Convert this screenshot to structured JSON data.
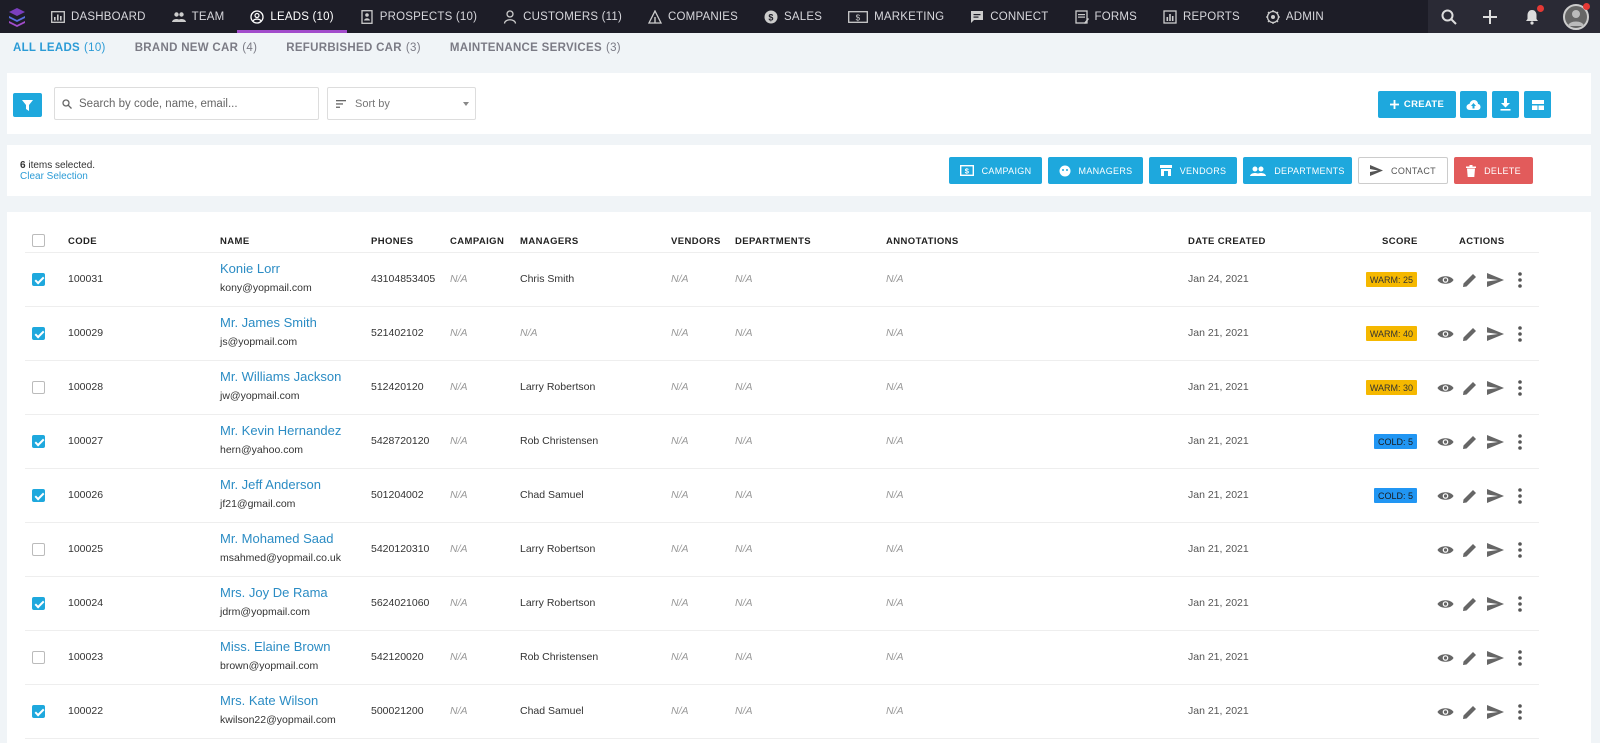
{
  "nav": {
    "items": [
      {
        "label": "DASHBOARD",
        "icon": "dashboard-icon"
      },
      {
        "label": "TEAM",
        "icon": "team-icon"
      },
      {
        "label": "LEADS (10)",
        "icon": "leads-icon",
        "active": true
      },
      {
        "label": "PROSPECTS (10)",
        "icon": "prospects-icon"
      },
      {
        "label": "CUSTOMERS (11)",
        "icon": "customers-icon"
      },
      {
        "label": "COMPANIES",
        "icon": "companies-icon"
      },
      {
        "label": "SALES",
        "icon": "sales-icon"
      },
      {
        "label": "MARKETING",
        "icon": "marketing-icon"
      },
      {
        "label": "CONNECT",
        "icon": "connect-icon"
      },
      {
        "label": "FORMS",
        "icon": "forms-icon"
      },
      {
        "label": "REPORTS",
        "icon": "reports-icon"
      },
      {
        "label": "ADMIN",
        "icon": "admin-icon"
      }
    ]
  },
  "subtabs": [
    {
      "label": "ALL LEADS",
      "count": "(10)",
      "active": true
    },
    {
      "label": "BRAND NEW CAR",
      "count": "(4)"
    },
    {
      "label": "REFURBISHED CAR",
      "count": "(3)"
    },
    {
      "label": "MAINTENANCE SERVICES",
      "count": "(3)"
    }
  ],
  "toolbar": {
    "search_placeholder": "Search by code, name, email...",
    "sort_label": "Sort by",
    "create_label": "CREATE"
  },
  "selection": {
    "count": "6",
    "text": " items selected.",
    "clear_label": "Clear Selection",
    "actions": [
      {
        "label": "CAMPAIGN",
        "icon": "campaign-icon"
      },
      {
        "label": "MANAGERS",
        "icon": "managers-icon"
      },
      {
        "label": "VENDORS",
        "icon": "vendors-icon"
      },
      {
        "label": "DEPARTMENTS",
        "icon": "departments-icon"
      },
      {
        "label": "CONTACT",
        "icon": "send-icon"
      },
      {
        "label": "DELETE",
        "icon": "trash-icon"
      }
    ]
  },
  "table": {
    "headers": {
      "code": "CODE",
      "name": "NAME",
      "phones": "PHONES",
      "campaign": "CAMPAIGN",
      "managers": "MANAGERS",
      "vendors": "VENDORS",
      "departments": "DEPARTMENTS",
      "annotations": "ANNOTATIONS",
      "date_created": "DATE CREATED",
      "score": "SCORE",
      "actions": "ACTIONS"
    },
    "rows": [
      {
        "checked": true,
        "code": "100031",
        "name": "Konie Lorr",
        "email": "kony@yopmail.com",
        "phone": "43104853405",
        "campaign": "N/A",
        "manager": "Chris Smith",
        "manager_na": false,
        "vendors": "N/A",
        "departments": "N/A",
        "annotations": "N/A",
        "date": "Jan 24, 2021",
        "score": "WARM: 25",
        "score_type": "warm"
      },
      {
        "checked": true,
        "code": "100029",
        "name": "Mr. James Smith",
        "email": "js@yopmail.com",
        "phone": "521402102",
        "campaign": "N/A",
        "manager": "N/A",
        "manager_na": true,
        "vendors": "N/A",
        "departments": "N/A",
        "annotations": "N/A",
        "date": "Jan 21, 2021",
        "score": "WARM: 40",
        "score_type": "warm"
      },
      {
        "checked": false,
        "code": "100028",
        "name": "Mr. Williams Jackson",
        "email": "jw@yopmail.com",
        "phone": "512420120",
        "campaign": "N/A",
        "manager": "Larry Robertson",
        "manager_na": false,
        "vendors": "N/A",
        "departments": "N/A",
        "annotations": "N/A",
        "date": "Jan 21, 2021",
        "score": "WARM: 30",
        "score_type": "warm"
      },
      {
        "checked": true,
        "code": "100027",
        "name": "Mr. Kevin Hernandez",
        "email": "hern@yahoo.com",
        "phone": "5428720120",
        "campaign": "N/A",
        "manager": "Rob Christensen",
        "manager_na": false,
        "vendors": "N/A",
        "departments": "N/A",
        "annotations": "N/A",
        "date": "Jan 21, 2021",
        "score": "COLD: 5",
        "score_type": "cold"
      },
      {
        "checked": true,
        "code": "100026",
        "name": "Mr. Jeff Anderson",
        "email": "jf21@gmail.com",
        "phone": "501204002",
        "campaign": "N/A",
        "manager": "Chad Samuel",
        "manager_na": false,
        "vendors": "N/A",
        "departments": "N/A",
        "annotations": "N/A",
        "date": "Jan 21, 2021",
        "score": "COLD: 5",
        "score_type": "cold"
      },
      {
        "checked": false,
        "code": "100025",
        "name": "Mr. Mohamed Saad",
        "email": "msahmed@yopmail.co.uk",
        "phone": "5420120310",
        "campaign": "N/A",
        "manager": "Larry Robertson",
        "manager_na": false,
        "vendors": "N/A",
        "departments": "N/A",
        "annotations": "N/A",
        "date": "Jan 21, 2021",
        "score": "",
        "score_type": ""
      },
      {
        "checked": true,
        "code": "100024",
        "name": "Mrs. Joy De Rama",
        "email": "jdrm@yopmail.com",
        "phone": "5624021060",
        "campaign": "N/A",
        "manager": "Larry Robertson",
        "manager_na": false,
        "vendors": "N/A",
        "departments": "N/A",
        "annotations": "N/A",
        "date": "Jan 21, 2021",
        "score": "",
        "score_type": ""
      },
      {
        "checked": false,
        "code": "100023",
        "name": "Miss. Elaine Brown",
        "email": "brown@yopmail.com",
        "phone": "542120020",
        "campaign": "N/A",
        "manager": "Rob Christensen",
        "manager_na": false,
        "vendors": "N/A",
        "departments": "N/A",
        "annotations": "N/A",
        "date": "Jan 21, 2021",
        "score": "",
        "score_type": ""
      },
      {
        "checked": true,
        "code": "100022",
        "name": "Mrs. Kate Wilson",
        "email": "kwilson22@yopmail.com",
        "phone": "500021200",
        "campaign": "N/A",
        "manager": "Chad Samuel",
        "manager_na": false,
        "vendors": "N/A",
        "departments": "N/A",
        "annotations": "N/A",
        "date": "Jan 21, 2021",
        "score": "",
        "score_type": ""
      }
    ]
  },
  "colors": {
    "accent": "#1ea8dd",
    "nav_bg": "#1d1d27",
    "active_tab_underline": "#a24ccb",
    "warm": "#f5b800",
    "cold": "#2196f3",
    "delete": "#e25b5b",
    "link": "#2b8cc4"
  }
}
